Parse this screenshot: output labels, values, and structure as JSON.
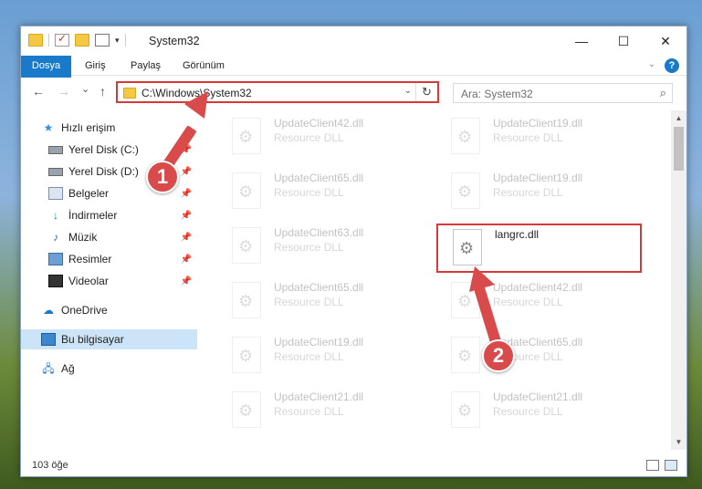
{
  "window": {
    "title": "System32",
    "controls": {
      "minimize": "—",
      "maximize": "☐",
      "close": "✕"
    }
  },
  "ribbon": {
    "tabs": [
      "Dosya",
      "Giriş",
      "Paylaş",
      "Görünüm"
    ],
    "expand_icon": "chevron-down-icon",
    "help": "?"
  },
  "navigation": {
    "back": "←",
    "forward": "→",
    "recent": "⌄",
    "up": "↑",
    "address": "C:\\Windows\\System32",
    "address_dropdown": "⌄",
    "refresh": "↻",
    "search_placeholder": "Ara: System32",
    "search_icon": "⌕"
  },
  "sidebar": {
    "quick_access": "Hızlı erişim",
    "items": [
      {
        "label": "Yerel Disk (C:)",
        "pinned": true
      },
      {
        "label": "Yerel Disk (D:)",
        "pinned": true
      },
      {
        "label": "Belgeler",
        "pinned": true
      },
      {
        "label": "İndirmeler",
        "pinned": true
      },
      {
        "label": "Müzik",
        "pinned": true
      },
      {
        "label": "Resimler",
        "pinned": true
      },
      {
        "label": "Videolar",
        "pinned": true
      }
    ],
    "onedrive": "OneDrive",
    "this_pc": "Bu bilgisayar",
    "network": "Ağ"
  },
  "files": [
    {
      "name": "UpdateClient42.dll",
      "type": "Resource DLL"
    },
    {
      "name": "UpdateClient19.dll",
      "type": "Resource DLL"
    },
    {
      "name": "UpdateClient65.dll",
      "type": "Resource DLL"
    },
    {
      "name": "UpdateClient19.dll",
      "type": "Resource DLL"
    },
    {
      "name": "UpdateClient63.dll",
      "type": "Resource DLL"
    },
    {
      "name": "langrc.dll",
      "type": ""
    },
    {
      "name": "UpdateClient65.dll",
      "type": "Resource DLL"
    },
    {
      "name": "UpdateClient42.dll",
      "type": "Resource DLL"
    },
    {
      "name": "UpdateClient19.dll",
      "type": "Resource DLL"
    },
    {
      "name": "UpdateClient65.dll",
      "type": "Resource DLL"
    },
    {
      "name": "UpdateClient21.dll",
      "type": "Resource DLL"
    },
    {
      "name": "UpdateClient21.dll",
      "type": "Resource DLL"
    }
  ],
  "status": {
    "count": "103 öğe"
  },
  "annotations": {
    "step1": "1",
    "step2": "2",
    "color": "#d94b4b"
  }
}
